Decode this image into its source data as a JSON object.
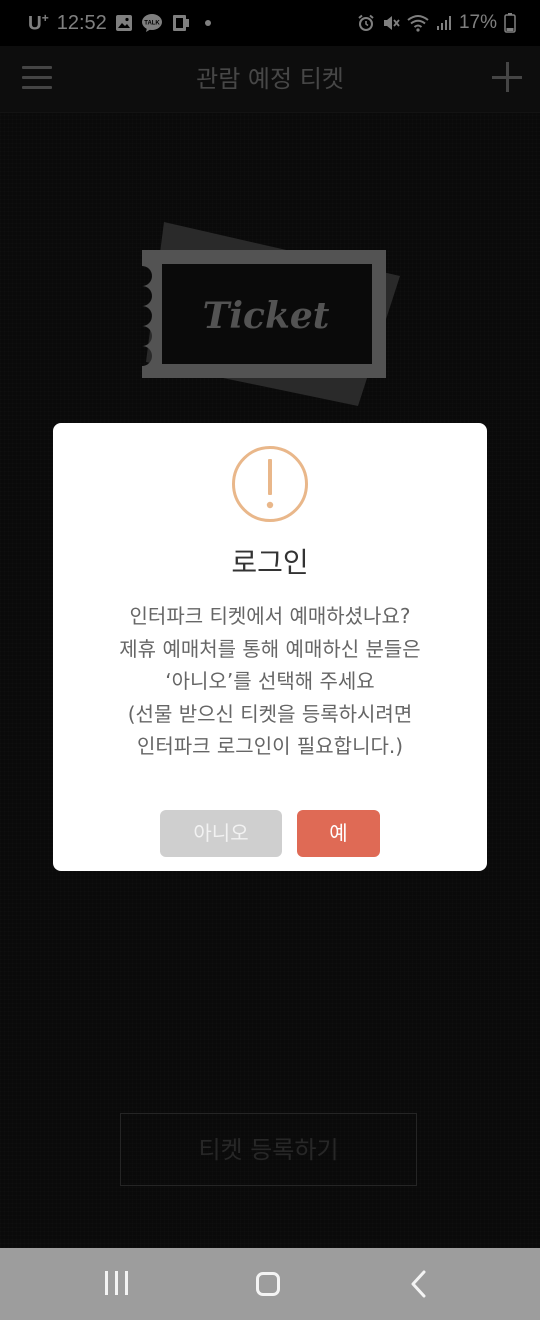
{
  "status_bar": {
    "carrier": "U",
    "carrier_sup": "+",
    "time": "12:52",
    "battery": "17%"
  },
  "header": {
    "title": "관람 예정 티켓"
  },
  "illustration": {
    "ticket_word": "Ticket"
  },
  "main": {
    "register_label": "티켓 등록하기"
  },
  "dialog": {
    "title": "로그인",
    "message_lines": [
      "인터파크 티켓에서 예매하셨나요?",
      "제휴 예매처를 통해 예매하신 분들은",
      "‘아니오’를 선택해 주세요",
      "(선물 받으신 티켓을 등록하시려면",
      "인터파크 로그인이 필요합니다.)"
    ],
    "no_label": "아니오",
    "yes_label": "예"
  },
  "colors": {
    "accent_orange": "#e9b78a",
    "yes_button": "#df6a55",
    "no_button": "#cfcfcf",
    "nav_bar": "#9d9d9d"
  }
}
